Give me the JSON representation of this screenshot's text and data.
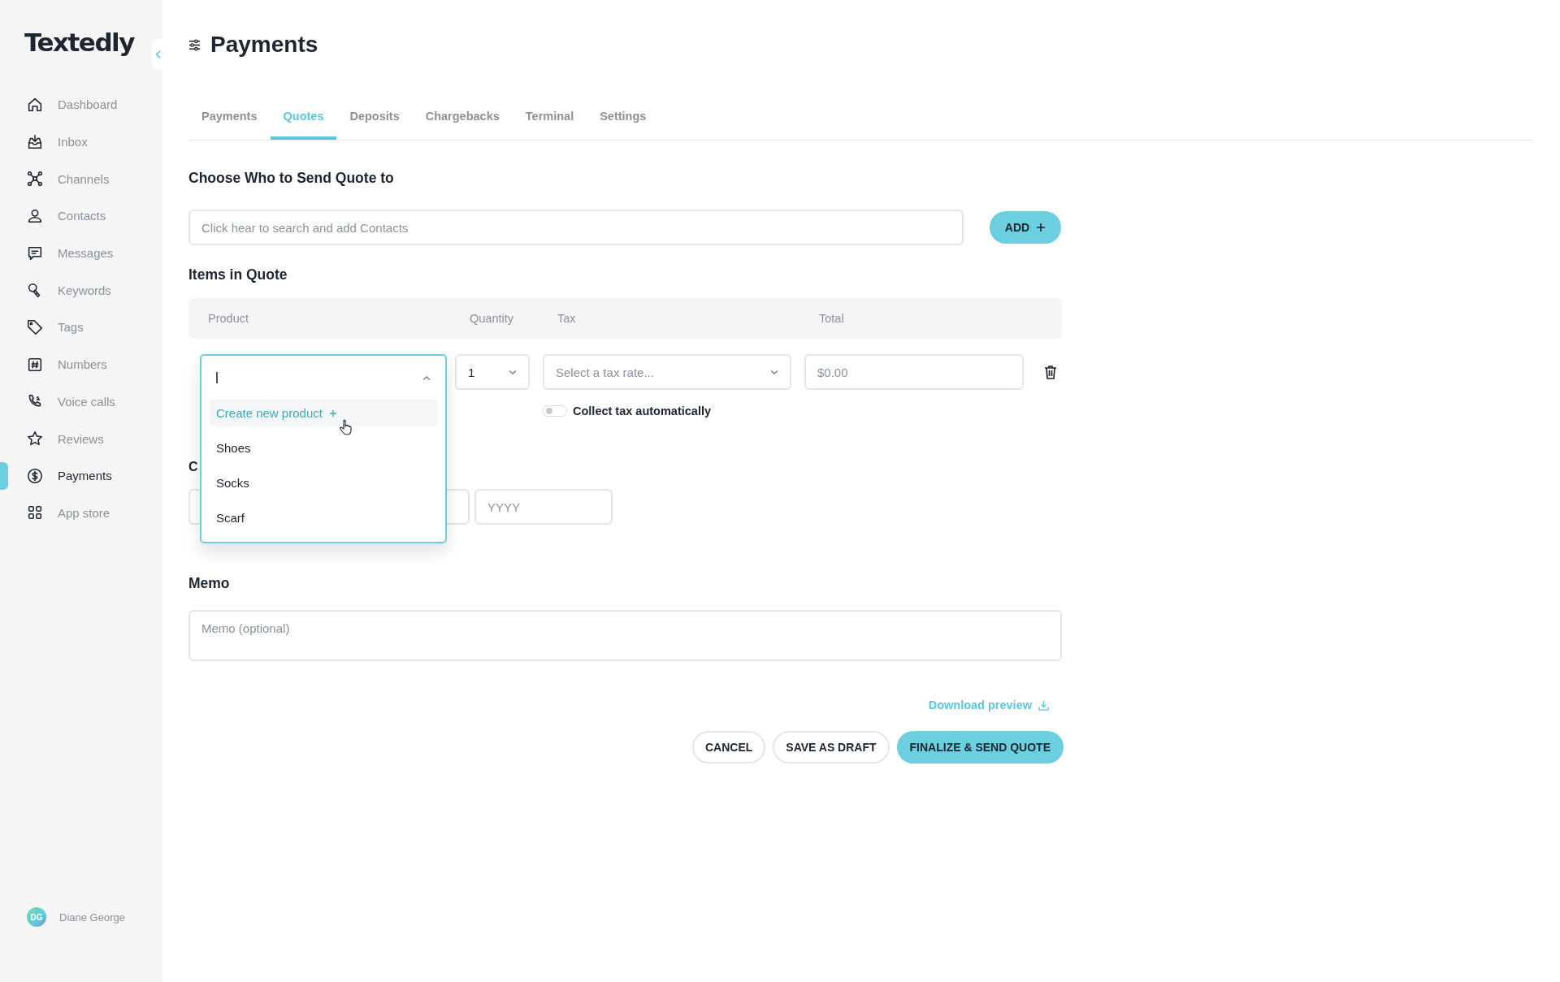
{
  "app": {
    "logo": "Textedly"
  },
  "sidebar": {
    "items": [
      {
        "label": "Dashboard",
        "selected": false
      },
      {
        "label": "Inbox",
        "selected": false
      },
      {
        "label": "Channels",
        "selected": false
      },
      {
        "label": "Contacts",
        "selected": false
      },
      {
        "label": "Messages",
        "selected": false
      },
      {
        "label": "Keywords",
        "selected": false
      },
      {
        "label": "Tags",
        "selected": false
      },
      {
        "label": "Numbers",
        "selected": false
      },
      {
        "label": "Voice calls",
        "selected": false
      },
      {
        "label": "Reviews",
        "selected": false
      },
      {
        "label": "Payments",
        "selected": true
      },
      {
        "label": "App store",
        "selected": false
      }
    ],
    "user": {
      "initials": "DG",
      "name": "Diane George"
    }
  },
  "page": {
    "title": "Payments"
  },
  "tabs": [
    {
      "label": "Payments",
      "selected": false
    },
    {
      "label": "Quotes",
      "selected": true
    },
    {
      "label": "Deposits",
      "selected": false
    },
    {
      "label": "Chargebacks",
      "selected": false
    },
    {
      "label": "Terminal",
      "selected": false
    },
    {
      "label": "Settings",
      "selected": false
    }
  ],
  "recipient": {
    "heading": "Choose Who to Send Quote to",
    "search": {
      "placeholder": "Click hear to search and add Contacts"
    },
    "add_button": "ADD"
  },
  "items": {
    "heading": "Items in Quote",
    "columns": [
      "Product",
      "Quantity",
      "Tax",
      "Total"
    ],
    "row": {
      "product_menu": {
        "options": [
          {
            "label": "Create new product",
            "kind": "create",
            "selected": true
          },
          {
            "label": "Shoes",
            "kind": "product",
            "selected": false
          },
          {
            "label": "Socks",
            "kind": "product",
            "selected": false
          },
          {
            "label": "Scarf",
            "kind": "product",
            "selected": false
          }
        ]
      },
      "quantity": "1",
      "tax": {
        "placeholder": "Select a tax rate..."
      },
      "total": {
        "placeholder": "$0.00"
      },
      "collect_tax": {
        "label": "Collect tax automatically",
        "on": false
      }
    }
  },
  "date_section": {
    "heading": "C",
    "year_field": {
      "placeholder": "YYYY"
    }
  },
  "memo": {
    "heading": "Memo",
    "field": {
      "placeholder": "Memo (optional)"
    }
  },
  "download_link": "Download preview",
  "buttons": [
    {
      "label": "CANCEL",
      "kind": "outline"
    },
    {
      "label": "SAVE AS DRAFT",
      "kind": "outline"
    },
    {
      "label": "FINALIZE & SEND QUOTE",
      "kind": "primary"
    }
  ]
}
